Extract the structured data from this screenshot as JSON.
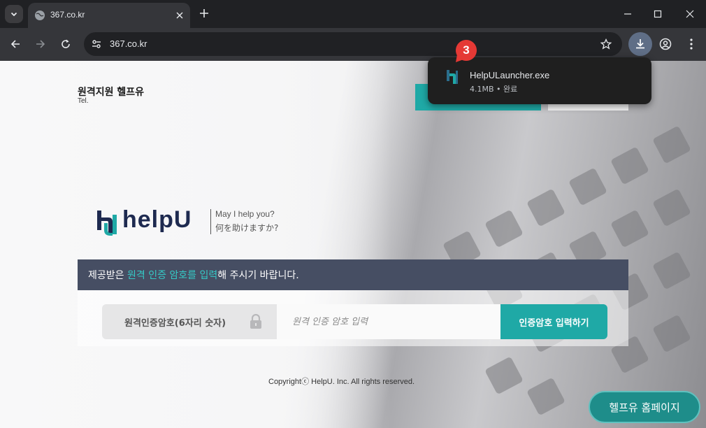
{
  "browser": {
    "tab_title": "367.co.kr",
    "url": "367.co.kr"
  },
  "download": {
    "badge_count": "3",
    "filename": "HelpULauncher.exe",
    "meta": "4.1MB • 완료"
  },
  "page": {
    "brand_title": "원격지원 헬프유",
    "brand_tel": "Tel.",
    "logo": {
      "wordmark": "helpU",
      "tagline_en": "May I help you?",
      "tagline_ja": "何を助けますか?"
    },
    "banner": {
      "before": "제공받은 ",
      "highlight": "원격 인증 암호를 입력",
      "after": "해 주시기 바랍니다."
    },
    "auth": {
      "label": "원격인증암호(6자리 숫자)",
      "placeholder": "원격 인증 암호 입력",
      "submit": "인증암호 입력하기"
    },
    "copyright": "Copyrightⓒ HelpU. Inc. All rights reserved.",
    "home_button": "헬프유 홈페이지"
  },
  "colors": {
    "accent_teal": "#1fa9a6",
    "banner_bg": "#464e63",
    "navy": "#1e2a50"
  }
}
